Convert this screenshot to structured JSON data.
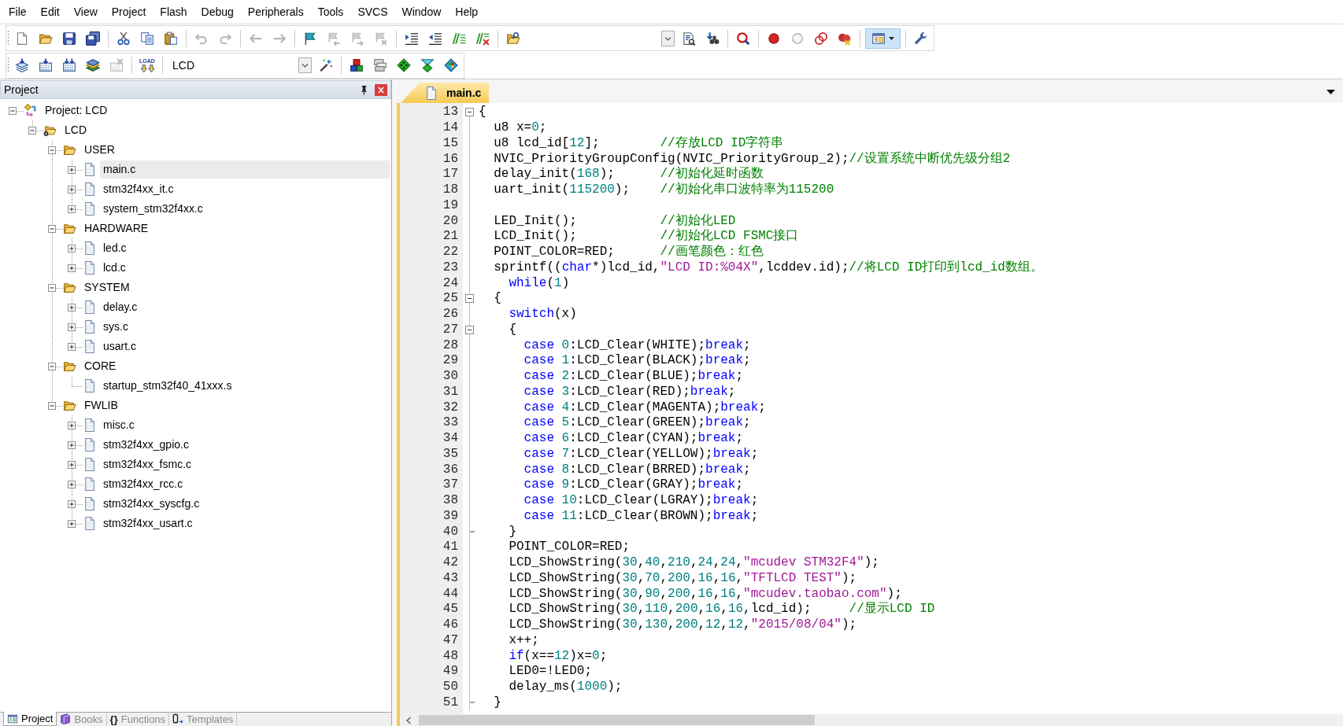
{
  "menu_bar": [
    "File",
    "Edit",
    "View",
    "Project",
    "Flash",
    "Debug",
    "Peripherals",
    "Tools",
    "SVCS",
    "Window",
    "Help"
  ],
  "toolbar_1": {
    "buttons": [
      {
        "disabled": false,
        "pressed": false
      },
      {
        "disabled": false,
        "pressed": false
      },
      {
        "disabled": false,
        "pressed": false
      },
      {
        "disabled": false,
        "pressed": false
      },
      {
        "disabled": false,
        "pressed": false
      },
      {
        "disabled": false,
        "pressed": false
      },
      {
        "disabled": false,
        "pressed": false
      },
      {
        "disabled": true,
        "pressed": false
      },
      {
        "disabled": true,
        "pressed": false
      },
      {
        "disabled": true,
        "pressed": false
      },
      {
        "disabled": true,
        "pressed": false
      },
      {
        "disabled": false,
        "pressed": false
      },
      {
        "disabled": true,
        "pressed": false
      },
      {
        "disabled": true,
        "pressed": false
      },
      {
        "disabled": true,
        "pressed": false
      },
      {
        "disabled": false,
        "pressed": false
      },
      {
        "disabled": false,
        "pressed": false
      },
      {
        "disabled": false,
        "pressed": false
      },
      {
        "disabled": false,
        "pressed": false
      },
      {
        "disabled": false,
        "pressed": false
      },
      {
        "disabled": false,
        "pressed": false
      },
      {
        "disabled": false,
        "pressed": false
      },
      {
        "disabled": false,
        "pressed": false
      },
      {
        "disabled": false,
        "pressed": false
      },
      {
        "disabled": false,
        "pressed": false
      },
      {
        "disabled": false,
        "pressed": false
      },
      {
        "disabled": false,
        "pressed": false
      },
      {
        "disabled": false,
        "pressed": true
      },
      {
        "disabled": false,
        "pressed": false
      }
    ]
  },
  "toolbar_2": {
    "buttons": [
      {
        "disabled": false,
        "pressed": false
      },
      {
        "disabled": false,
        "pressed": false
      },
      {
        "disabled": false,
        "pressed": false
      },
      {
        "disabled": false,
        "pressed": false
      },
      {
        "disabled": true,
        "pressed": false
      },
      {
        "disabled": false,
        "pressed": false,
        "label": "LOAD"
      },
      {
        "disabled": false,
        "pressed": false
      },
      {
        "disabled": false,
        "pressed": false
      },
      {
        "disabled": false,
        "pressed": false
      },
      {
        "disabled": false,
        "pressed": false
      },
      {
        "disabled": false,
        "pressed": false
      },
      {
        "disabled": false,
        "pressed": false
      }
    ],
    "target_select": {
      "value": "LCD"
    }
  },
  "project_panel": {
    "title": "Project",
    "tree": [
      {
        "label": "Project: LCD",
        "kind": "project",
        "expanded": true,
        "selected": false,
        "children": [
          {
            "label": "LCD",
            "kind": "target",
            "expanded": true,
            "selected": false,
            "children": [
              {
                "label": "USER",
                "kind": "group",
                "expanded": true,
                "selected": false,
                "children": [
                  {
                    "label": "main.c",
                    "kind": "file",
                    "expanded": false,
                    "selected": true
                  },
                  {
                    "label": "stm32f4xx_it.c",
                    "kind": "file",
                    "expanded": false,
                    "selected": false
                  },
                  {
                    "label": "system_stm32f4xx.c",
                    "kind": "file",
                    "expanded": false,
                    "selected": false
                  }
                ]
              },
              {
                "label": "HARDWARE",
                "kind": "group",
                "expanded": true,
                "selected": false,
                "children": [
                  {
                    "label": "led.c",
                    "kind": "file",
                    "expanded": false,
                    "selected": false
                  },
                  {
                    "label": "lcd.c",
                    "kind": "file",
                    "expanded": false,
                    "selected": false
                  }
                ]
              },
              {
                "label": "SYSTEM",
                "kind": "group",
                "expanded": true,
                "selected": false,
                "children": [
                  {
                    "label": "delay.c",
                    "kind": "file",
                    "expanded": false,
                    "selected": false
                  },
                  {
                    "label": "sys.c",
                    "kind": "file",
                    "expanded": false,
                    "selected": false
                  },
                  {
                    "label": "usart.c",
                    "kind": "file",
                    "expanded": false,
                    "selected": false
                  }
                ]
              },
              {
                "label": "CORE",
                "kind": "group",
                "expanded": true,
                "selected": false,
                "children": [
                  {
                    "label": "startup_stm32f40_41xxx.s",
                    "kind": "file",
                    "selected": false
                  }
                ]
              },
              {
                "label": "FWLIB",
                "kind": "group",
                "expanded": true,
                "selected": false,
                "children": [
                  {
                    "label": "misc.c",
                    "kind": "file",
                    "expanded": false,
                    "selected": false
                  },
                  {
                    "label": "stm32f4xx_gpio.c",
                    "kind": "file",
                    "expanded": false,
                    "selected": false
                  },
                  {
                    "label": "stm32f4xx_fsmc.c",
                    "kind": "file",
                    "expanded": false,
                    "selected": false
                  },
                  {
                    "label": "stm32f4xx_rcc.c",
                    "kind": "file",
                    "expanded": false,
                    "selected": false
                  },
                  {
                    "label": "stm32f4xx_syscfg.c",
                    "kind": "file",
                    "expanded": false,
                    "selected": false
                  },
                  {
                    "label": "stm32f4xx_usart.c",
                    "kind": "file",
                    "expanded": false,
                    "selected": false
                  }
                ]
              }
            ]
          }
        ]
      }
    ],
    "tabs": [
      {
        "label": "Project",
        "selected": true
      },
      {
        "label": "Books",
        "selected": false
      },
      {
        "label": "Functions",
        "selected": false,
        "glyph": "{}"
      },
      {
        "label": "Templates",
        "selected": false
      }
    ]
  },
  "editor": {
    "tabs": [
      {
        "label": "main.c",
        "selected": true
      }
    ],
    "lines": [
      {
        "number": "13",
        "kind": "fold",
        "tokens": [
          {
            "kind": "plain",
            "text": "{"
          }
        ]
      },
      {
        "number": "14",
        "kind": "plain",
        "tokens": [
          {
            "kind": "plain",
            "text": "  u8 x="
          },
          {
            "kind": "number",
            "text": "0"
          },
          {
            "kind": "plain",
            "text": ";"
          }
        ]
      },
      {
        "number": "15",
        "kind": "plain",
        "tokens": [
          {
            "kind": "plain",
            "text": "  u8 lcd_id["
          },
          {
            "kind": "number",
            "text": "12"
          },
          {
            "kind": "plain",
            "text": "];        "
          },
          {
            "kind": "comment",
            "text": "//存放LCD ID字符串"
          }
        ]
      },
      {
        "number": "16",
        "kind": "plain",
        "tokens": [
          {
            "kind": "plain",
            "text": "  NVIC_PriorityGroupConfig(NVIC_PriorityGroup_2);"
          },
          {
            "kind": "comment",
            "text": "//设置系统中断优先级分组2"
          }
        ]
      },
      {
        "number": "17",
        "kind": "plain",
        "tokens": [
          {
            "kind": "plain",
            "text": "  delay_init("
          },
          {
            "kind": "number",
            "text": "168"
          },
          {
            "kind": "plain",
            "text": ");      "
          },
          {
            "kind": "comment",
            "text": "//初始化延时函数"
          }
        ]
      },
      {
        "number": "18",
        "kind": "plain",
        "tokens": [
          {
            "kind": "plain",
            "text": "  uart_init("
          },
          {
            "kind": "number",
            "text": "115200"
          },
          {
            "kind": "plain",
            "text": ");    "
          },
          {
            "kind": "comment",
            "text": "//初始化串口波特率为115200"
          }
        ]
      },
      {
        "number": "19",
        "kind": "plain"
      },
      {
        "number": "20",
        "kind": "plain",
        "tokens": [
          {
            "kind": "plain",
            "text": "  LED_Init();           "
          },
          {
            "kind": "comment",
            "text": "//初始化LED"
          }
        ]
      },
      {
        "number": "21",
        "kind": "plain",
        "tokens": [
          {
            "kind": "plain",
            "text": "  LCD_Init();           "
          },
          {
            "kind": "comment",
            "text": "//初始化LCD FSMC接口"
          }
        ]
      },
      {
        "number": "22",
        "kind": "plain",
        "tokens": [
          {
            "kind": "plain",
            "text": "  POINT_COLOR=RED;      "
          },
          {
            "kind": "comment",
            "text": "//画笔颜色：红色"
          }
        ]
      },
      {
        "number": "23",
        "kind": "plain",
        "tokens": [
          {
            "kind": "plain",
            "text": "  sprintf(("
          },
          {
            "kind": "keyword",
            "text": "char"
          },
          {
            "kind": "plain",
            "text": "*)lcd_id,"
          },
          {
            "kind": "string",
            "text": "\"LCD ID:%04X\""
          },
          {
            "kind": "plain",
            "text": ",lcddev.id);"
          },
          {
            "kind": "comment",
            "text": "//将LCD ID打印到lcd_id数组。"
          }
        ]
      },
      {
        "number": "24",
        "kind": "plain",
        "tokens": [
          {
            "kind": "keyword",
            "text": "    while"
          },
          {
            "kind": "plain",
            "text": "("
          },
          {
            "kind": "number",
            "text": "1"
          },
          {
            "kind": "plain",
            "text": ")"
          }
        ]
      },
      {
        "number": "25",
        "kind": "fold",
        "tokens": [
          {
            "kind": "plain",
            "text": "  {"
          }
        ]
      },
      {
        "number": "26",
        "kind": "plain",
        "tokens": [
          {
            "kind": "keyword",
            "text": "    switch"
          },
          {
            "kind": "plain",
            "text": "(x)"
          }
        ]
      },
      {
        "number": "27",
        "kind": "fold",
        "tokens": [
          {
            "kind": "plain",
            "text": "    {"
          }
        ]
      },
      {
        "number": "28",
        "kind": "plain",
        "tokens": [
          {
            "kind": "keyword",
            "text": "      case"
          },
          {
            "kind": "number",
            "text": " 0"
          },
          {
            "kind": "plain",
            "text": ":LCD_Clear(WHITE);"
          },
          {
            "kind": "keyword",
            "text": "break"
          },
          {
            "kind": "plain",
            "text": ";"
          }
        ]
      },
      {
        "number": "29",
        "kind": "plain",
        "tokens": [
          {
            "kind": "keyword",
            "text": "      case"
          },
          {
            "kind": "number",
            "text": " 1"
          },
          {
            "kind": "plain",
            "text": ":LCD_Clear(BLACK);"
          },
          {
            "kind": "keyword",
            "text": "break"
          },
          {
            "kind": "plain",
            "text": ";"
          }
        ]
      },
      {
        "number": "30",
        "kind": "plain",
        "tokens": [
          {
            "kind": "keyword",
            "text": "      case"
          },
          {
            "kind": "number",
            "text": " 2"
          },
          {
            "kind": "plain",
            "text": ":LCD_Clear(BLUE);"
          },
          {
            "kind": "keyword",
            "text": "break"
          },
          {
            "kind": "plain",
            "text": ";"
          }
        ]
      },
      {
        "number": "31",
        "kind": "plain",
        "tokens": [
          {
            "kind": "keyword",
            "text": "      case"
          },
          {
            "kind": "number",
            "text": " 3"
          },
          {
            "kind": "plain",
            "text": ":LCD_Clear(RED);"
          },
          {
            "kind": "keyword",
            "text": "break"
          },
          {
            "kind": "plain",
            "text": ";"
          }
        ]
      },
      {
        "number": "32",
        "kind": "plain",
        "tokens": [
          {
            "kind": "keyword",
            "text": "      case"
          },
          {
            "kind": "number",
            "text": " 4"
          },
          {
            "kind": "plain",
            "text": ":LCD_Clear(MAGENTA);"
          },
          {
            "kind": "keyword",
            "text": "break"
          },
          {
            "kind": "plain",
            "text": ";"
          }
        ]
      },
      {
        "number": "33",
        "kind": "plain",
        "tokens": [
          {
            "kind": "keyword",
            "text": "      case"
          },
          {
            "kind": "number",
            "text": " 5"
          },
          {
            "kind": "plain",
            "text": ":LCD_Clear(GREEN);"
          },
          {
            "kind": "keyword",
            "text": "break"
          },
          {
            "kind": "plain",
            "text": ";"
          }
        ]
      },
      {
        "number": "34",
        "kind": "plain",
        "tokens": [
          {
            "kind": "keyword",
            "text": "      case"
          },
          {
            "kind": "number",
            "text": " 6"
          },
          {
            "kind": "plain",
            "text": ":LCD_Clear(CYAN);"
          },
          {
            "kind": "keyword",
            "text": "break"
          },
          {
            "kind": "plain",
            "text": ";"
          }
        ]
      },
      {
        "number": "35",
        "kind": "plain",
        "tokens": [
          {
            "kind": "keyword",
            "text": "      case"
          },
          {
            "kind": "number",
            "text": " 7"
          },
          {
            "kind": "plain",
            "text": ":LCD_Clear(YELLOW);"
          },
          {
            "kind": "keyword",
            "text": "break"
          },
          {
            "kind": "plain",
            "text": ";"
          }
        ]
      },
      {
        "number": "36",
        "kind": "plain",
        "tokens": [
          {
            "kind": "keyword",
            "text": "      case"
          },
          {
            "kind": "number",
            "text": " 8"
          },
          {
            "kind": "plain",
            "text": ":LCD_Clear(BRRED);"
          },
          {
            "kind": "keyword",
            "text": "break"
          },
          {
            "kind": "plain",
            "text": ";"
          }
        ]
      },
      {
        "number": "37",
        "kind": "plain",
        "tokens": [
          {
            "kind": "keyword",
            "text": "      case"
          },
          {
            "kind": "number",
            "text": " 9"
          },
          {
            "kind": "plain",
            "text": ":LCD_Clear(GRAY);"
          },
          {
            "kind": "keyword",
            "text": "break"
          },
          {
            "kind": "plain",
            "text": ";"
          }
        ]
      },
      {
        "number": "38",
        "kind": "plain",
        "tokens": [
          {
            "kind": "keyword",
            "text": "      case"
          },
          {
            "kind": "number",
            "text": " 10"
          },
          {
            "kind": "plain",
            "text": ":LCD_Clear(LGRAY);"
          },
          {
            "kind": "keyword",
            "text": "break"
          },
          {
            "kind": "plain",
            "text": ";"
          }
        ]
      },
      {
        "number": "39",
        "kind": "plain",
        "tokens": [
          {
            "kind": "keyword",
            "text": "      case"
          },
          {
            "kind": "number",
            "text": " 11"
          },
          {
            "kind": "plain",
            "text": ":LCD_Clear(BROWN);"
          },
          {
            "kind": "keyword",
            "text": "break"
          },
          {
            "kind": "plain",
            "text": ";"
          }
        ]
      },
      {
        "number": "40",
        "kind": "foldend",
        "tokens": [
          {
            "kind": "plain",
            "text": "    }"
          }
        ]
      },
      {
        "number": "41",
        "kind": "plain",
        "tokens": [
          {
            "kind": "plain",
            "text": "    POINT_COLOR=RED;"
          }
        ]
      },
      {
        "number": "42",
        "kind": "plain",
        "tokens": [
          {
            "kind": "plain",
            "text": "    LCD_ShowString("
          },
          {
            "kind": "number",
            "text": "30"
          },
          {
            "kind": "plain",
            "text": ","
          },
          {
            "kind": "number",
            "text": "40"
          },
          {
            "kind": "plain",
            "text": ","
          },
          {
            "kind": "number",
            "text": "210"
          },
          {
            "kind": "plain",
            "text": ","
          },
          {
            "kind": "number",
            "text": "24"
          },
          {
            "kind": "plain",
            "text": ","
          },
          {
            "kind": "number",
            "text": "24"
          },
          {
            "kind": "plain",
            "text": ","
          },
          {
            "kind": "string",
            "text": "\"mcudev STM32F4\""
          },
          {
            "kind": "plain",
            "text": ");"
          }
        ]
      },
      {
        "number": "43",
        "kind": "plain",
        "tokens": [
          {
            "kind": "plain",
            "text": "    LCD_ShowString("
          },
          {
            "kind": "number",
            "text": "30"
          },
          {
            "kind": "plain",
            "text": ","
          },
          {
            "kind": "number",
            "text": "70"
          },
          {
            "kind": "plain",
            "text": ","
          },
          {
            "kind": "number",
            "text": "200"
          },
          {
            "kind": "plain",
            "text": ","
          },
          {
            "kind": "number",
            "text": "16"
          },
          {
            "kind": "plain",
            "text": ","
          },
          {
            "kind": "number",
            "text": "16"
          },
          {
            "kind": "plain",
            "text": ","
          },
          {
            "kind": "string",
            "text": "\"TFTLCD TEST\""
          },
          {
            "kind": "plain",
            "text": ");"
          }
        ]
      },
      {
        "number": "44",
        "kind": "plain",
        "tokens": [
          {
            "kind": "plain",
            "text": "    LCD_ShowString("
          },
          {
            "kind": "number",
            "text": "30"
          },
          {
            "kind": "plain",
            "text": ","
          },
          {
            "kind": "number",
            "text": "90"
          },
          {
            "kind": "plain",
            "text": ","
          },
          {
            "kind": "number",
            "text": "200"
          },
          {
            "kind": "plain",
            "text": ","
          },
          {
            "kind": "number",
            "text": "16"
          },
          {
            "kind": "plain",
            "text": ","
          },
          {
            "kind": "number",
            "text": "16"
          },
          {
            "kind": "plain",
            "text": ","
          },
          {
            "kind": "string",
            "text": "\"mcudev.taobao.com\""
          },
          {
            "kind": "plain",
            "text": ");"
          }
        ]
      },
      {
        "number": "45",
        "kind": "plain",
        "tokens": [
          {
            "kind": "plain",
            "text": "    LCD_ShowString("
          },
          {
            "kind": "number",
            "text": "30"
          },
          {
            "kind": "plain",
            "text": ","
          },
          {
            "kind": "number",
            "text": "110"
          },
          {
            "kind": "plain",
            "text": ","
          },
          {
            "kind": "number",
            "text": "200"
          },
          {
            "kind": "plain",
            "text": ","
          },
          {
            "kind": "number",
            "text": "16"
          },
          {
            "kind": "plain",
            "text": ","
          },
          {
            "kind": "number",
            "text": "16"
          },
          {
            "kind": "plain",
            "text": ",lcd_id);     "
          },
          {
            "kind": "comment",
            "text": "//显示LCD ID"
          }
        ]
      },
      {
        "number": "46",
        "kind": "plain",
        "tokens": [
          {
            "kind": "plain",
            "text": "    LCD_ShowString("
          },
          {
            "kind": "number",
            "text": "30"
          },
          {
            "kind": "plain",
            "text": ","
          },
          {
            "kind": "number",
            "text": "130"
          },
          {
            "kind": "plain",
            "text": ","
          },
          {
            "kind": "number",
            "text": "200"
          },
          {
            "kind": "plain",
            "text": ","
          },
          {
            "kind": "number",
            "text": "12"
          },
          {
            "kind": "plain",
            "text": ","
          },
          {
            "kind": "number",
            "text": "12"
          },
          {
            "kind": "plain",
            "text": ","
          },
          {
            "kind": "string",
            "text": "\"2015/08/04\""
          },
          {
            "kind": "plain",
            "text": ");"
          }
        ]
      },
      {
        "number": "47",
        "kind": "plain",
        "tokens": [
          {
            "kind": "plain",
            "text": "    x++;"
          }
        ]
      },
      {
        "number": "48",
        "kind": "plain",
        "tokens": [
          {
            "kind": "keyword",
            "text": "    if"
          },
          {
            "kind": "plain",
            "text": "(x=="
          },
          {
            "kind": "number",
            "text": "12"
          },
          {
            "kind": "plain",
            "text": ")x="
          },
          {
            "kind": "number",
            "text": "0"
          },
          {
            "kind": "plain",
            "text": ";"
          }
        ]
      },
      {
        "number": "49",
        "kind": "plain",
        "tokens": [
          {
            "kind": "plain",
            "text": "    LED0=!LED0;"
          }
        ]
      },
      {
        "number": "50",
        "kind": "plain",
        "tokens": [
          {
            "kind": "plain",
            "text": "    delay_ms("
          },
          {
            "kind": "number",
            "text": "1000"
          },
          {
            "kind": "plain",
            "text": ");"
          }
        ]
      },
      {
        "number": "51",
        "kind": "foldend",
        "tokens": [
          {
            "kind": "plain",
            "text": "  }"
          }
        ]
      }
    ]
  }
}
